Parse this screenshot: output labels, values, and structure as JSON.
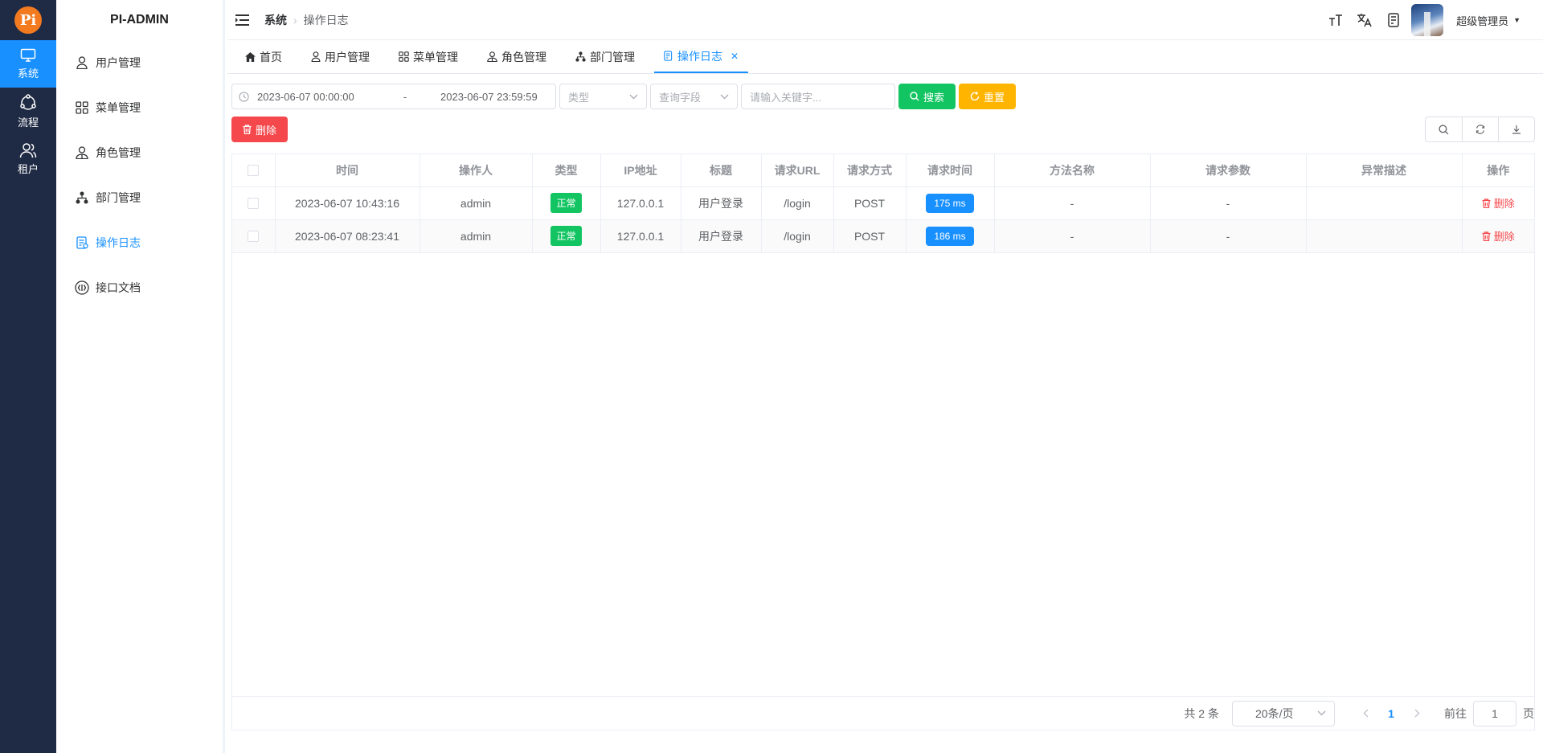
{
  "app": {
    "logo_text": "Pi",
    "brand": "PI-ADMIN"
  },
  "rail": [
    {
      "label": "系统",
      "icon": "monitor-icon",
      "active": true
    },
    {
      "label": "流程",
      "icon": "workflow-icon",
      "active": false
    },
    {
      "label": "租户",
      "icon": "users-icon",
      "active": false
    }
  ],
  "sidebar": {
    "items": [
      {
        "label": "用户管理",
        "icon": "user-icon"
      },
      {
        "label": "菜单管理",
        "icon": "grid-icon"
      },
      {
        "label": "角色管理",
        "icon": "role-icon"
      },
      {
        "label": "部门管理",
        "icon": "org-icon"
      },
      {
        "label": "操作日志",
        "icon": "log-icon",
        "active": true
      },
      {
        "label": "接口文档",
        "icon": "api-icon"
      }
    ]
  },
  "header": {
    "breadcrumb": [
      "系统",
      "操作日志"
    ],
    "user": "超级管理员",
    "icons": [
      "font-size-icon",
      "translate-icon",
      "document-icon"
    ]
  },
  "tabs": [
    {
      "label": "首页",
      "icon": "home-icon"
    },
    {
      "label": "用户管理",
      "icon": "user-icon"
    },
    {
      "label": "菜单管理",
      "icon": "grid-icon"
    },
    {
      "label": "角色管理",
      "icon": "role-icon"
    },
    {
      "label": "部门管理",
      "icon": "org-icon"
    },
    {
      "label": "操作日志",
      "icon": "log-icon",
      "active": true,
      "closable": true
    }
  ],
  "filters": {
    "date_start": "2023-06-07 00:00:00",
    "date_sep": "-",
    "date_end": "2023-06-07 23:59:59",
    "type_placeholder": "类型",
    "field_placeholder": "查询字段",
    "keyword_placeholder": "请输入关键字...",
    "search_label": "搜索",
    "reset_label": "重置",
    "delete_label": "删除"
  },
  "table": {
    "columns": [
      "时间",
      "操作人",
      "类型",
      "IP地址",
      "标题",
      "请求URL",
      "请求方式",
      "请求时间",
      "方法名称",
      "请求参数",
      "异常描述",
      "操作"
    ],
    "rows": [
      {
        "time": "2023-06-07 10:43:16",
        "operator": "admin",
        "type": "正常",
        "ip": "127.0.0.1",
        "title": "用户登录",
        "url": "/login",
        "method": "POST",
        "duration": "175 ms",
        "method_name": "-",
        "params": "-",
        "error": "",
        "action": "删除"
      },
      {
        "time": "2023-06-07 08:23:41",
        "operator": "admin",
        "type": "正常",
        "ip": "127.0.0.1",
        "title": "用户登录",
        "url": "/login",
        "method": "POST",
        "duration": "186 ms",
        "method_name": "-",
        "params": "-",
        "error": "",
        "action": "删除"
      }
    ]
  },
  "pagination": {
    "total": "共 2 条",
    "page_size": "20条/页",
    "current_page": "1",
    "goto_label": "前往",
    "goto_value": "1",
    "page_suffix": "页"
  },
  "colors": {
    "primary": "#1890ff",
    "success": "#13c562",
    "warning": "#ffb400",
    "danger": "#f5484c",
    "rail": "#1f2a44"
  }
}
